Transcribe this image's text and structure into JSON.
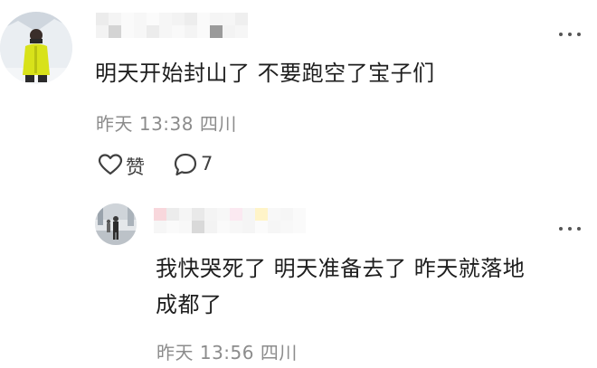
{
  "comments": [
    {
      "text": "明天开始封山了 不要跑空了宝子们",
      "meta": "昨天 13:38 四川",
      "like_label": "赞",
      "reply_count": "7",
      "avatar_icon": "user-avatar-snow-jacket"
    }
  ],
  "replies": [
    {
      "text_line1": "我快哭死了 明天准备去了 昨天就落地",
      "text_line2": "成都了",
      "meta": "昨天 13:56 四川",
      "avatar_icon": "user-avatar-street"
    }
  ],
  "icons": {
    "more": "more-dots-icon",
    "like": "heart-outline-icon",
    "reply": "comment-bubble-icon"
  }
}
